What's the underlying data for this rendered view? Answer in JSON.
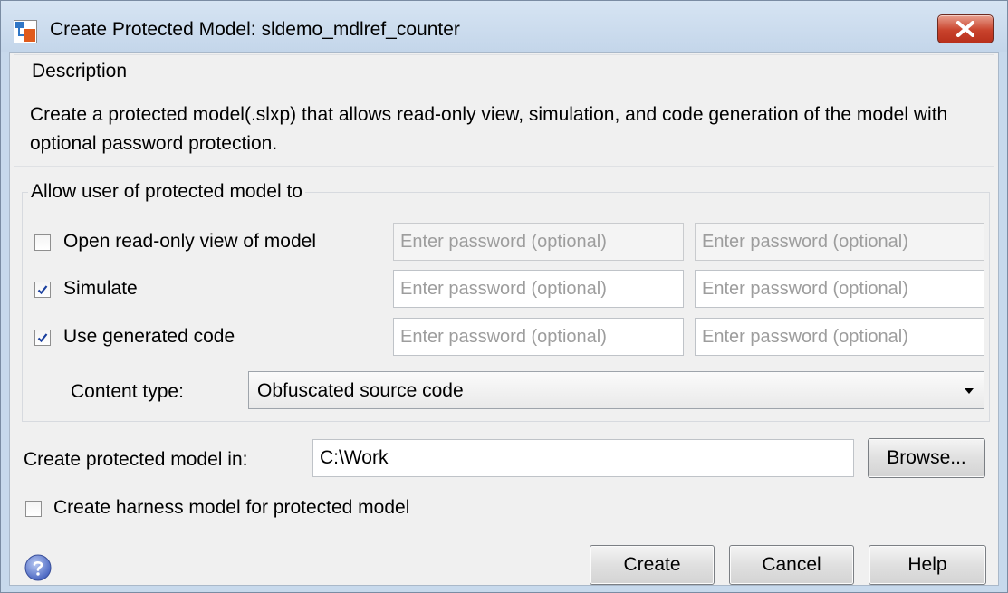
{
  "window": {
    "title": "Create Protected Model: sldemo_mdlref_counter",
    "close_icon": "close-icon"
  },
  "description": {
    "heading": "Description",
    "text": "Create a protected model(.slxp) that allows read-only view, simulation, and code generation of the model with optional password protection."
  },
  "permissions": {
    "heading": "Allow user of protected model to",
    "options": [
      {
        "label": "Open read-only view of model",
        "checked": false,
        "password_placeholder": "Enter password (optional)",
        "confirm_placeholder": "Enter password (optional)",
        "enabled": false
      },
      {
        "label": "Simulate",
        "checked": true,
        "password_placeholder": "Enter password (optional)",
        "confirm_placeholder": "Enter password (optional)",
        "enabled": true
      },
      {
        "label": "Use generated code",
        "checked": true,
        "password_placeholder": "Enter password (optional)",
        "confirm_placeholder": "Enter password (optional)",
        "enabled": true
      }
    ],
    "content_type_label": "Content type:",
    "content_type_value": "Obfuscated source code"
  },
  "location": {
    "label": "Create protected model in:",
    "value": "C:\\Work",
    "browse_label": "Browse..."
  },
  "harness": {
    "label": "Create harness model for protected model",
    "checked": false
  },
  "buttons": {
    "create": "Create",
    "cancel": "Cancel",
    "help": "Help"
  },
  "colors": {
    "accent_check": "#1a3f9e",
    "close_button": "#c9432c",
    "title_bar": "#c7d9ec"
  }
}
